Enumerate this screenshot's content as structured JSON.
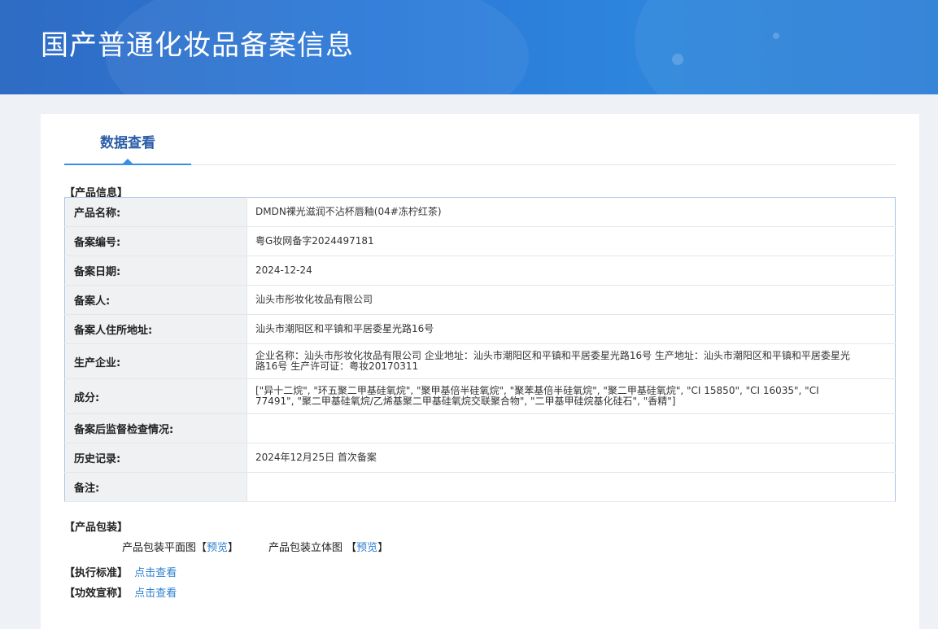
{
  "header": {
    "title": "国产普通化妆品备案信息"
  },
  "tab": {
    "label": "数据查看"
  },
  "sections": {
    "product_info": "【产品信息】",
    "packaging": "【产品包装】",
    "standard": "【执行标准】",
    "efficacy": "【功效宣称】"
  },
  "info_rows": [
    {
      "label": "产品名称:",
      "value": "DMDN裸光滋润不沾杯唇釉(04#冻柠红茶)"
    },
    {
      "label": "备案编号:",
      "value": "粤G妆网备字2024497181"
    },
    {
      "label": "备案日期:",
      "value": "2024-12-24"
    },
    {
      "label": "备案人:",
      "value": "汕头市彤妆化妆品有限公司"
    },
    {
      "label": "备案人住所地址:",
      "value": "汕头市潮阳区和平镇和平居委星光路16号"
    },
    {
      "label": "生产企业:",
      "value": "企业名称：汕头市彤妆化妆品有限公司 企业地址：汕头市潮阳区和平镇和平居委星光路16号 生产地址：汕头市潮阳区和平镇和平居委星光路16号 生产许可证：粤妆20170311"
    },
    {
      "label": "成分:",
      "value": "[\"异十二烷\", \"环五聚二甲基硅氧烷\", \"聚甲基倍半硅氧烷\", \"聚苯基倍半硅氧烷\", \"聚二甲基硅氧烷\", \"CI 15850\", \"CI 16035\", \"CI 77491\", \"聚二甲基硅氧烷/乙烯基聚二甲基硅氧烷交联聚合物\", \"二甲基甲硅烷基化硅石\", \"香精\"]"
    },
    {
      "label": "备案后监督检查情况:",
      "value": ""
    },
    {
      "label": "历史记录:",
      "value": "2024年12月25日 首次备案"
    },
    {
      "label": "备注:",
      "value": ""
    }
  ],
  "packaging": {
    "flat_label": "产品包装平面图",
    "flat_link": "预览",
    "three_d_label": "产品包装立体图",
    "three_d_link": "预览",
    "bracket_open": "【",
    "bracket_close": "】"
  },
  "links": {
    "standard_link": "点击查看",
    "efficacy_link": "点击查看"
  }
}
